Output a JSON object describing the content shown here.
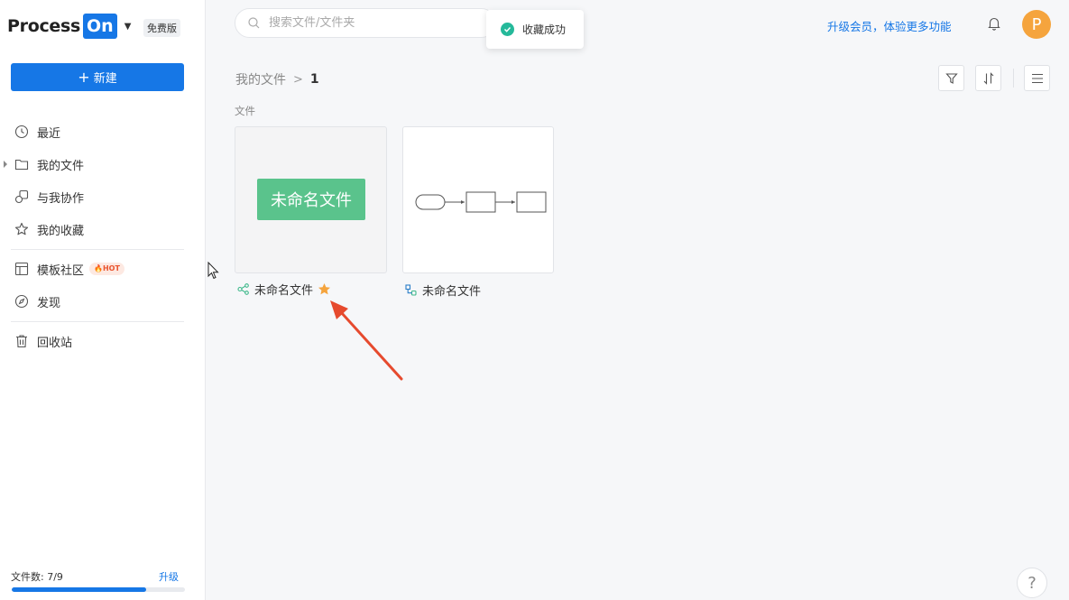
{
  "brand": {
    "name_part1": "Process",
    "name_part2": "On",
    "plan_badge": "免费版"
  },
  "sidebar": {
    "new_button": {
      "icon": "plus-icon",
      "label": "新建"
    },
    "items": [
      {
        "icon": "clock-icon",
        "label": "最近"
      },
      {
        "icon": "folder-icon",
        "label": "我的文件"
      },
      {
        "icon": "collaborate-icon",
        "label": "与我协作"
      },
      {
        "icon": "star-outline-icon",
        "label": "我的收藏"
      },
      {
        "icon": "template-icon",
        "label": "模板社区",
        "badge": "HOT"
      },
      {
        "icon": "compass-icon",
        "label": "发现"
      },
      {
        "icon": "trash-icon",
        "label": "回收站"
      }
    ],
    "quota": {
      "label": "文件数: 7/9",
      "used": 7,
      "total": 9,
      "upgrade_label": "升级"
    }
  },
  "topbar": {
    "search_placeholder": "搜索文件/文件夹",
    "upgrade_link": "升级会员，体验更多功能",
    "avatar_letter": "P"
  },
  "toast": {
    "message": "收藏成功"
  },
  "breadcrumb": {
    "root": "我的文件",
    "separator": ">",
    "current": "1"
  },
  "files_section_label": "文件",
  "files": [
    {
      "name": "未命名文件",
      "thumbnail_text": "未命名文件",
      "type_icon": "mindmap-icon",
      "starred": true
    },
    {
      "name": "未命名文件",
      "type_icon": "flowchart-icon",
      "starred": false
    }
  ],
  "help_label": "?",
  "colors": {
    "primary": "#1677e6",
    "success": "#25b99a",
    "thumb_green": "#5ac38c",
    "star": "#f5a43d",
    "annotation_red": "#e64a2e"
  }
}
